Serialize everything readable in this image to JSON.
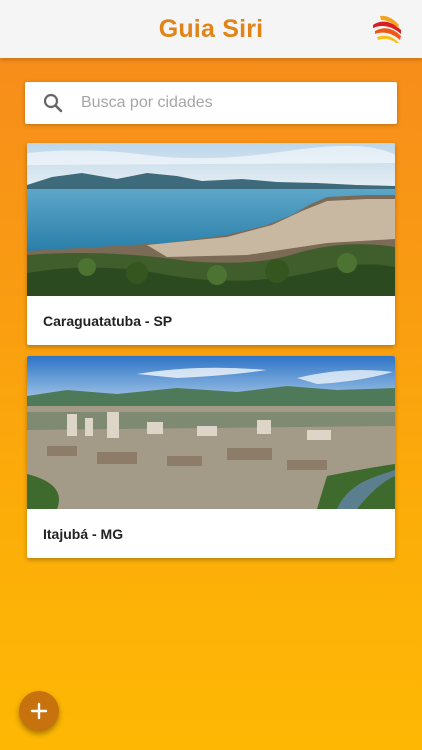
{
  "app": {
    "title": "Guia Siri",
    "logo_icon": "flame-wave-logo",
    "brand_color": "#e0841a"
  },
  "search": {
    "placeholder": "Busca por cidades",
    "value": "",
    "icon": "search-icon"
  },
  "cities": [
    {
      "name": "Caraguatatuba - SP",
      "image": "coastal bay city aerial photo"
    },
    {
      "name": "Itajubá - MG",
      "image": "inland city in valley aerial photo"
    }
  ],
  "fab": {
    "icon": "plus-icon",
    "color": "#c7720c"
  },
  "background": {
    "gradient_top": "#f6891d",
    "gradient_bottom": "#feb804"
  }
}
